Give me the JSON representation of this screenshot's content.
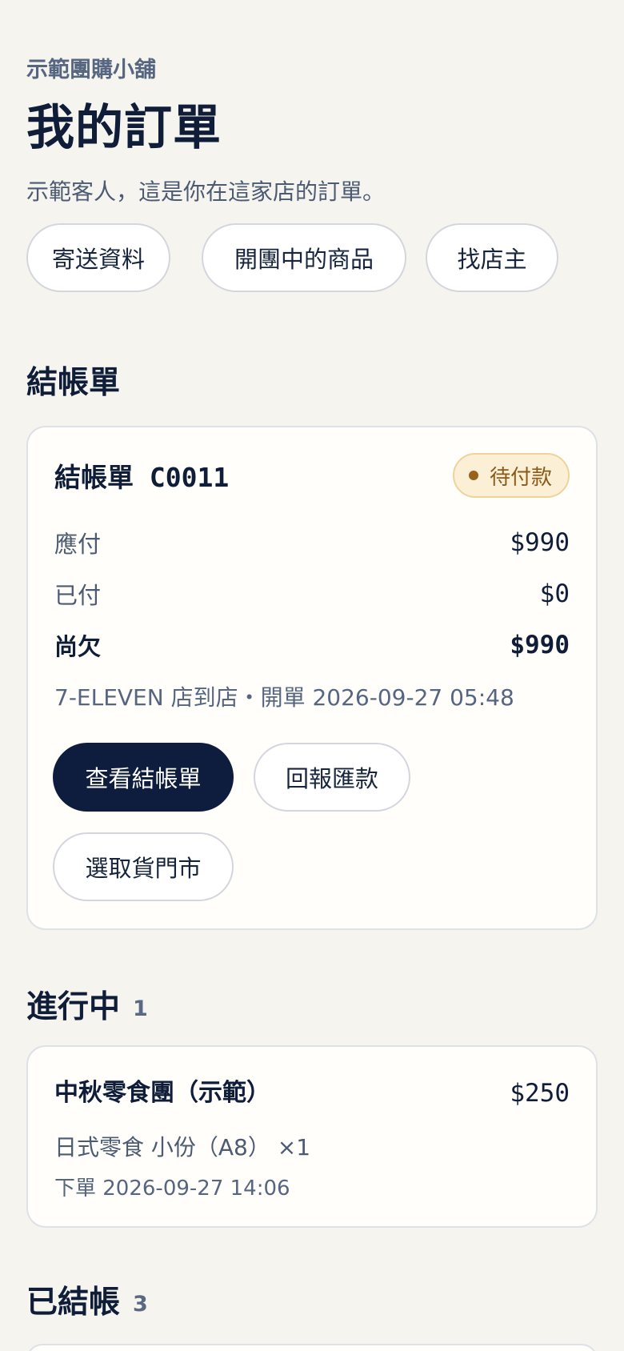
{
  "header": {
    "shop_name": "示範團購小舖",
    "title": "我的訂單",
    "subtitle": "示範客人，這是你在這家店的訂單。"
  },
  "quick_links": [
    {
      "label": "寄送資料"
    },
    {
      "label": "開團中的商品"
    },
    {
      "label": "找店主"
    }
  ],
  "checkout_section": {
    "title": "結帳單",
    "card": {
      "title": "結帳單 C0011",
      "status": "待付款",
      "status_color": "#9a611b",
      "rows": [
        {
          "label": "應付",
          "amount": "$990"
        },
        {
          "label": "已付",
          "amount": "$0"
        },
        {
          "label": "尚欠",
          "amount": "$990"
        }
      ],
      "meta": "7-ELEVEN 店到店・開單 2026-09-27 05:48",
      "actions": {
        "view": "查看結帳單",
        "report": "回報匯款",
        "store": "選取貨門市"
      }
    }
  },
  "in_progress_section": {
    "title": "進行中",
    "count": "1",
    "orders": [
      {
        "title": "中秋零食團（示範）",
        "price": "$250",
        "item": "日式零食 小份（A8） ×1",
        "time": "下單 2026-09-27 14:06"
      }
    ]
  },
  "settled_section": {
    "title": "已結帳",
    "count": "3"
  },
  "colors": {
    "background": "#f6f4ef",
    "primary": "#0e1d3d",
    "card": "#fffefb",
    "badge_bg": "#fbf0d6",
    "badge_border": "#edd39c"
  }
}
